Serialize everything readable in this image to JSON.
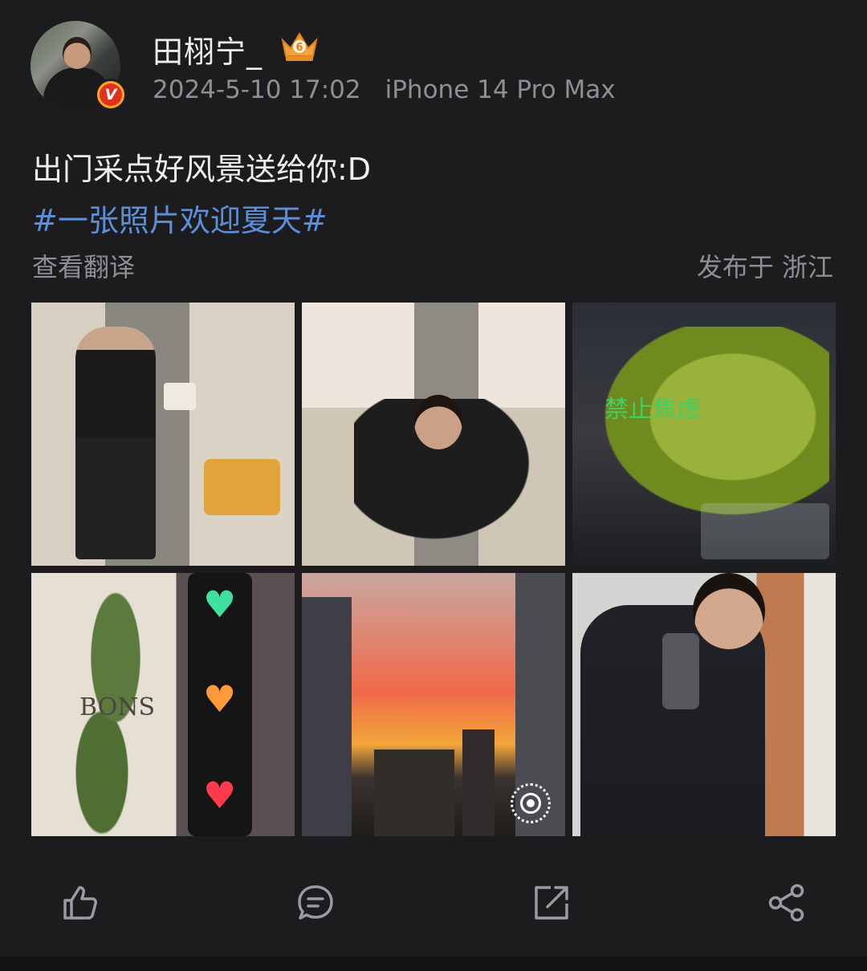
{
  "post": {
    "author": {
      "name": "田栩宁_",
      "verified_badge": "V",
      "rank_badge_level": "6"
    },
    "timestamp": "2024-5-10 17:02",
    "device": "iPhone 14 Pro Max",
    "text": "出门采点好风景送给你:D",
    "hashtag": "#一张照片欢迎夏天#",
    "translate_label": "查看翻译",
    "location": "发布于 浙江",
    "photos": [
      {
        "subject": "mirror selfie in room with yellow chair"
      },
      {
        "subject": "blurred mirror selfie seated"
      },
      {
        "subject": "green bananas in glass vase",
        "overlay_text": "禁止焦虑"
      },
      {
        "subject": "heart-shaped traffic lights with plant",
        "sign_text": "BONS"
      },
      {
        "subject": "sunset city skyline",
        "badge": "live-photo-icon"
      },
      {
        "subject": "mirror selfie holding phone"
      }
    ]
  },
  "actions": {
    "like": "like-icon",
    "comment": "comment-icon",
    "repost": "repost-icon",
    "share": "share-icon"
  },
  "colors": {
    "background": "#1c1c1e",
    "hashtag": "#5b8fd9",
    "meta_text": "#8e8e93",
    "primary_text": "#eeeeee"
  }
}
